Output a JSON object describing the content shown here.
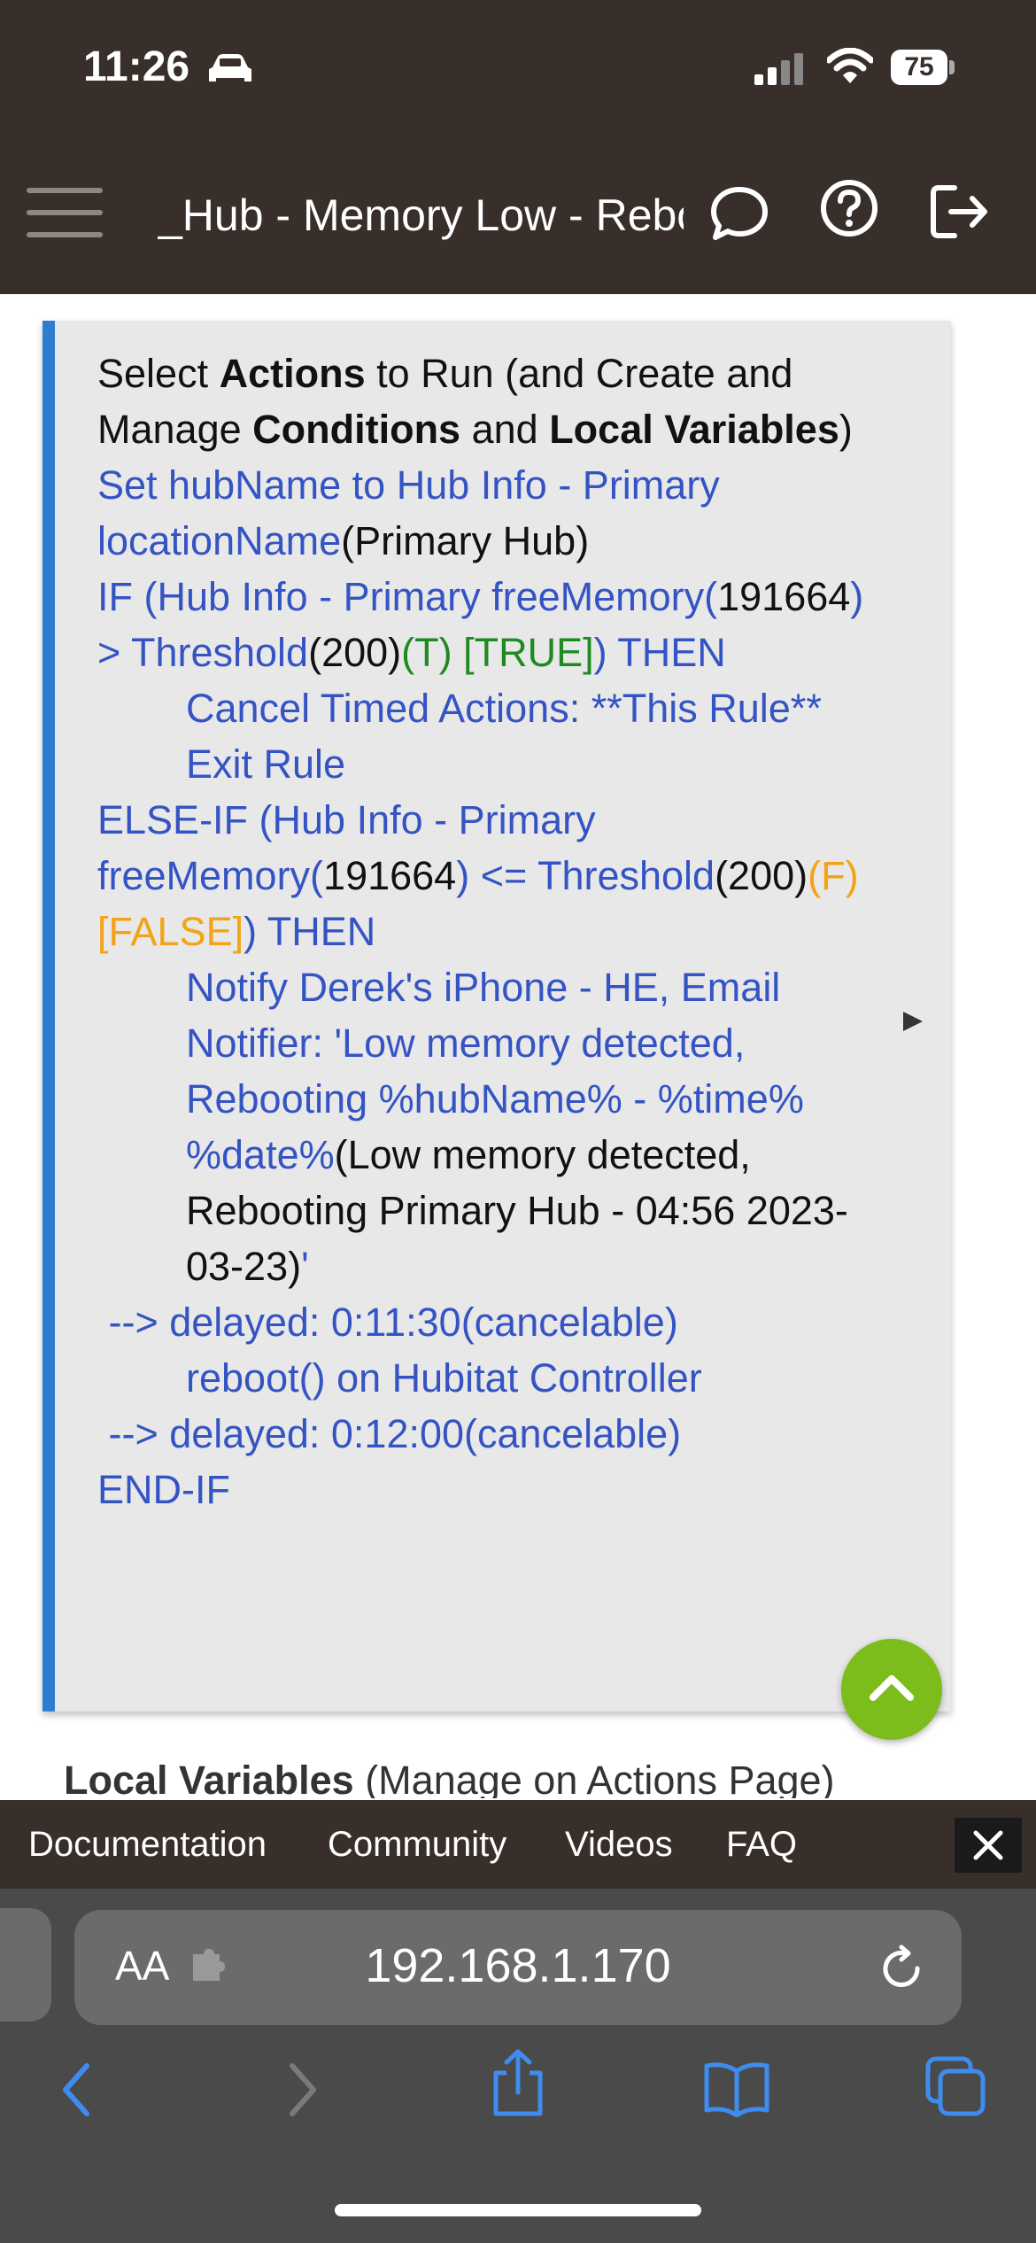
{
  "status_bar": {
    "time": "11:26",
    "battery": "75",
    "icons": [
      "car-icon",
      "signal-icon",
      "wifi-icon",
      "battery-icon"
    ]
  },
  "app_bar": {
    "title": "_Hub - Memory Low - Reboot",
    "icons": [
      "menu-icon",
      "chat-icon",
      "help-icon",
      "logout-icon"
    ]
  },
  "rule_card": {
    "heading": {
      "p1": "Select ",
      "b1": "Actions",
      "p2": " to Run (and Create and Manage ",
      "b2": "Conditions",
      "p3": " and ",
      "b3": "Local Variables",
      "p4": ")"
    },
    "l1": {
      "a": "Set hubName to Hub Info - Primary locationName",
      "b": "(Primary Hub)"
    },
    "l2": {
      "a": "IF (Hub Info - Primary freeMemory(",
      "b": "191664",
      "c": ") > Threshold",
      "d": "(200)",
      "e": "(T) [TRUE]",
      "f": ") THEN"
    },
    "l3": "Cancel Timed Actions: **This Rule**",
    "l4": "Exit Rule",
    "l5": {
      "a": "ELSE-IF (Hub Info - Primary freeMemory(",
      "b": "191664",
      "c": ") <= Threshold",
      "d": "(200)",
      "e": "(F) [FALSE]",
      "f": ") THEN"
    },
    "l6": {
      "a": "Notify Derek's iPhone - HE, Email Notifier: 'Low memory detected, Rebooting %hubName% - %time% %date%",
      "b": "(Low memory detected, Rebooting Primary Hub - 04:56 2023-03-23)",
      "c": "'"
    },
    "l7": " --> delayed: 0:11:30(cancelable)",
    "l8": "reboot() on Hubitat Controller",
    "l9": " --> delayed: 0:12:00(cancelable)",
    "l10": "END-IF",
    "colors": {
      "action": "#3554c4",
      "true": "#1f8a1f",
      "false": "#f4a316",
      "accent": "#2f7dd1"
    }
  },
  "local_variables": {
    "bold": "Local Variables",
    "rest": " (Manage on Actions Page)"
  },
  "scroll_top_button": {
    "icon": "chevron-up-icon",
    "color": "#7cbd1b"
  },
  "footer": {
    "links": [
      "Documentation",
      "Community",
      "Videos",
      "FAQ"
    ],
    "close_icon": "close-icon"
  },
  "browser": {
    "aa_label": "AA",
    "url": "192.168.1.170",
    "icons": [
      "puzzle-icon",
      "reload-icon",
      "back-icon",
      "forward-icon",
      "share-icon",
      "bookmarks-icon",
      "tabs-icon"
    ],
    "accent": "#3f8cf0"
  },
  "theme": {
    "bar": "#382e2a",
    "card": "#e8e8e8"
  }
}
